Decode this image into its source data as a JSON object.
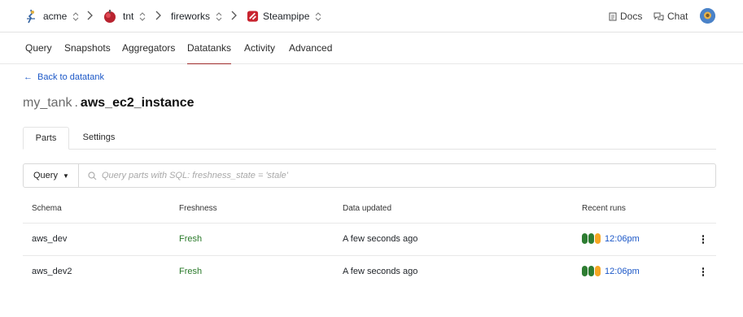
{
  "breadcrumbs": [
    {
      "label": "acme",
      "icon": "acme-logo-icon"
    },
    {
      "label": "tnt",
      "icon": "tnt-logo-icon"
    },
    {
      "label": "fireworks",
      "icon": ""
    },
    {
      "label": "Steampipe",
      "icon": "steampipe-logo-icon"
    }
  ],
  "header": {
    "docs_label": "Docs",
    "chat_label": "Chat"
  },
  "nav": {
    "items": [
      "Query",
      "Snapshots",
      "Aggregators",
      "Datatanks",
      "Activity",
      "Advanced"
    ],
    "active": "Datatanks"
  },
  "back_link": "Back to datatank",
  "title": {
    "prefix": "my_tank",
    "dot": ".",
    "name": "aws_ec2_instance"
  },
  "subtabs": {
    "items": [
      "Parts",
      "Settings"
    ],
    "active": "Parts"
  },
  "query": {
    "button_label": "Query",
    "placeholder": "Query parts with SQL: freshness_state = 'stale'"
  },
  "table": {
    "columns": [
      "Schema",
      "Freshness",
      "Data updated",
      "Recent runs"
    ],
    "rows": [
      {
        "schema": "aws_dev",
        "freshness": "Fresh",
        "updated": "A few seconds ago",
        "run_time": "12:06pm"
      },
      {
        "schema": "aws_dev2",
        "freshness": "Fresh",
        "updated": "A few seconds ago",
        "run_time": "12:06pm"
      }
    ]
  },
  "colors": {
    "accent": "#9e2b2b",
    "link": "#1b57c7",
    "fresh": "#2a7a2a",
    "run_success": "#2e7d32",
    "run_warning": "#f5a623"
  }
}
